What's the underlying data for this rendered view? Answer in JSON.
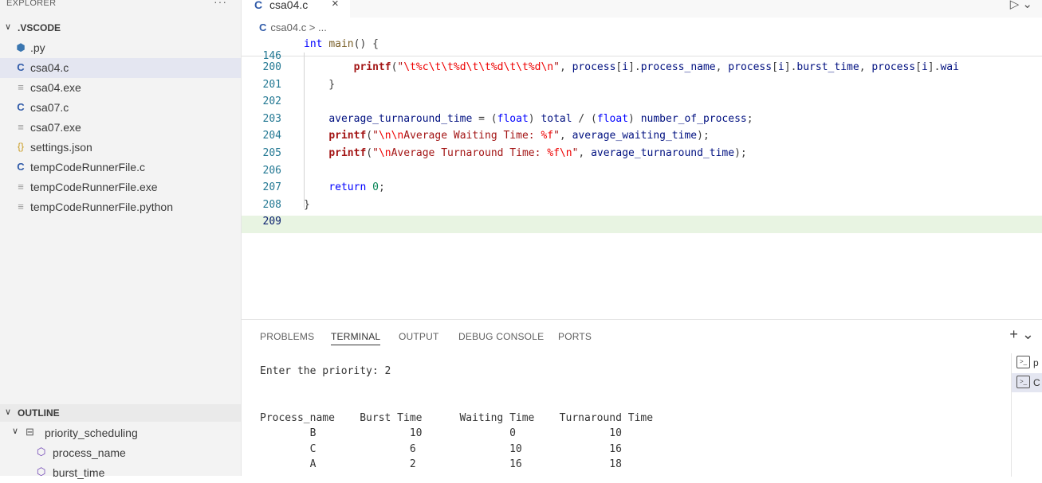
{
  "explorer": {
    "title": "EXPLORER",
    "more": "···",
    "folder": ".VSCODE",
    "files": [
      {
        "name": ".py",
        "icon": "python-file-icon",
        "glyph": "⬢",
        "cls": "ic-py",
        "selected": false
      },
      {
        "name": "csa04.c",
        "icon": "c-file-icon",
        "glyph": "C",
        "cls": "ic-c",
        "selected": true
      },
      {
        "name": "csa04.exe",
        "icon": "binary-file-icon",
        "glyph": "≡",
        "cls": "ic-exe",
        "selected": false
      },
      {
        "name": "csa07.c",
        "icon": "c-file-icon",
        "glyph": "C",
        "cls": "ic-c",
        "selected": false
      },
      {
        "name": "csa07.exe",
        "icon": "binary-file-icon",
        "glyph": "≡",
        "cls": "ic-exe",
        "selected": false
      },
      {
        "name": "settings.json",
        "icon": "json-file-icon",
        "glyph": "{}",
        "cls": "ic-json",
        "selected": false
      },
      {
        "name": "tempCodeRunnerFile.c",
        "icon": "c-file-icon",
        "glyph": "C",
        "cls": "ic-c",
        "selected": false
      },
      {
        "name": "tempCodeRunnerFile.exe",
        "icon": "binary-file-icon",
        "glyph": "≡",
        "cls": "ic-exe",
        "selected": false
      },
      {
        "name": "tempCodeRunnerFile.python",
        "icon": "binary-file-icon",
        "glyph": "≡",
        "cls": "ic-exe",
        "selected": false
      }
    ]
  },
  "outline": {
    "title": "OUTLINE",
    "struct": "priority_scheduling",
    "fields": [
      "process_name",
      "burst_time"
    ]
  },
  "editor": {
    "tab": {
      "name": "csa04.c",
      "close": "×"
    },
    "run_icon": "▷ ⌄",
    "breadcrumb": "csa04.c > ...",
    "sticky": {
      "num": "146",
      "code": "int main() {"
    },
    "lines": [
      {
        "num": "200",
        "code": "        printf(\"\\t%c\\t\\t%d\\t\\t%d\\t\\t%d\\n\", process[i].process_name, process[i].burst_time, process[i].wai"
      },
      {
        "num": "201",
        "code": "    }"
      },
      {
        "num": "202",
        "code": ""
      },
      {
        "num": "203",
        "code": "    average_turnaround_time = (float) total / (float) number_of_process;"
      },
      {
        "num": "204",
        "code": "    printf(\"\\n\\nAverage Waiting Time: %f\", average_waiting_time);"
      },
      {
        "num": "205",
        "code": "    printf(\"\\nAverage Turnaround Time: %f\\n\", average_turnaround_time);"
      },
      {
        "num": "206",
        "code": ""
      },
      {
        "num": "207",
        "code": "    return 0;"
      },
      {
        "num": "208",
        "code": "}"
      },
      {
        "num": "209",
        "code": ""
      }
    ],
    "current_line": "209"
  },
  "panel": {
    "tabs": [
      "PROBLEMS",
      "TERMINAL",
      "OUTPUT",
      "DEBUG CONSOLE",
      "PORTS"
    ],
    "active_tab": "TERMINAL",
    "new_terminal": "+ ⌄",
    "terminal_lines": [
      "Enter the priority: 2",
      "",
      "",
      "Process_name    Burst Time      Waiting Time    Turnaround Time",
      "        B               10              0               10",
      "        C               6               10              16",
      "        A               2               16              18"
    ],
    "terminals": [
      {
        "label": "p",
        "icon": "terminal-icon",
        "selected": false
      },
      {
        "label": "C",
        "icon": "terminal-icon",
        "selected": true
      }
    ]
  }
}
